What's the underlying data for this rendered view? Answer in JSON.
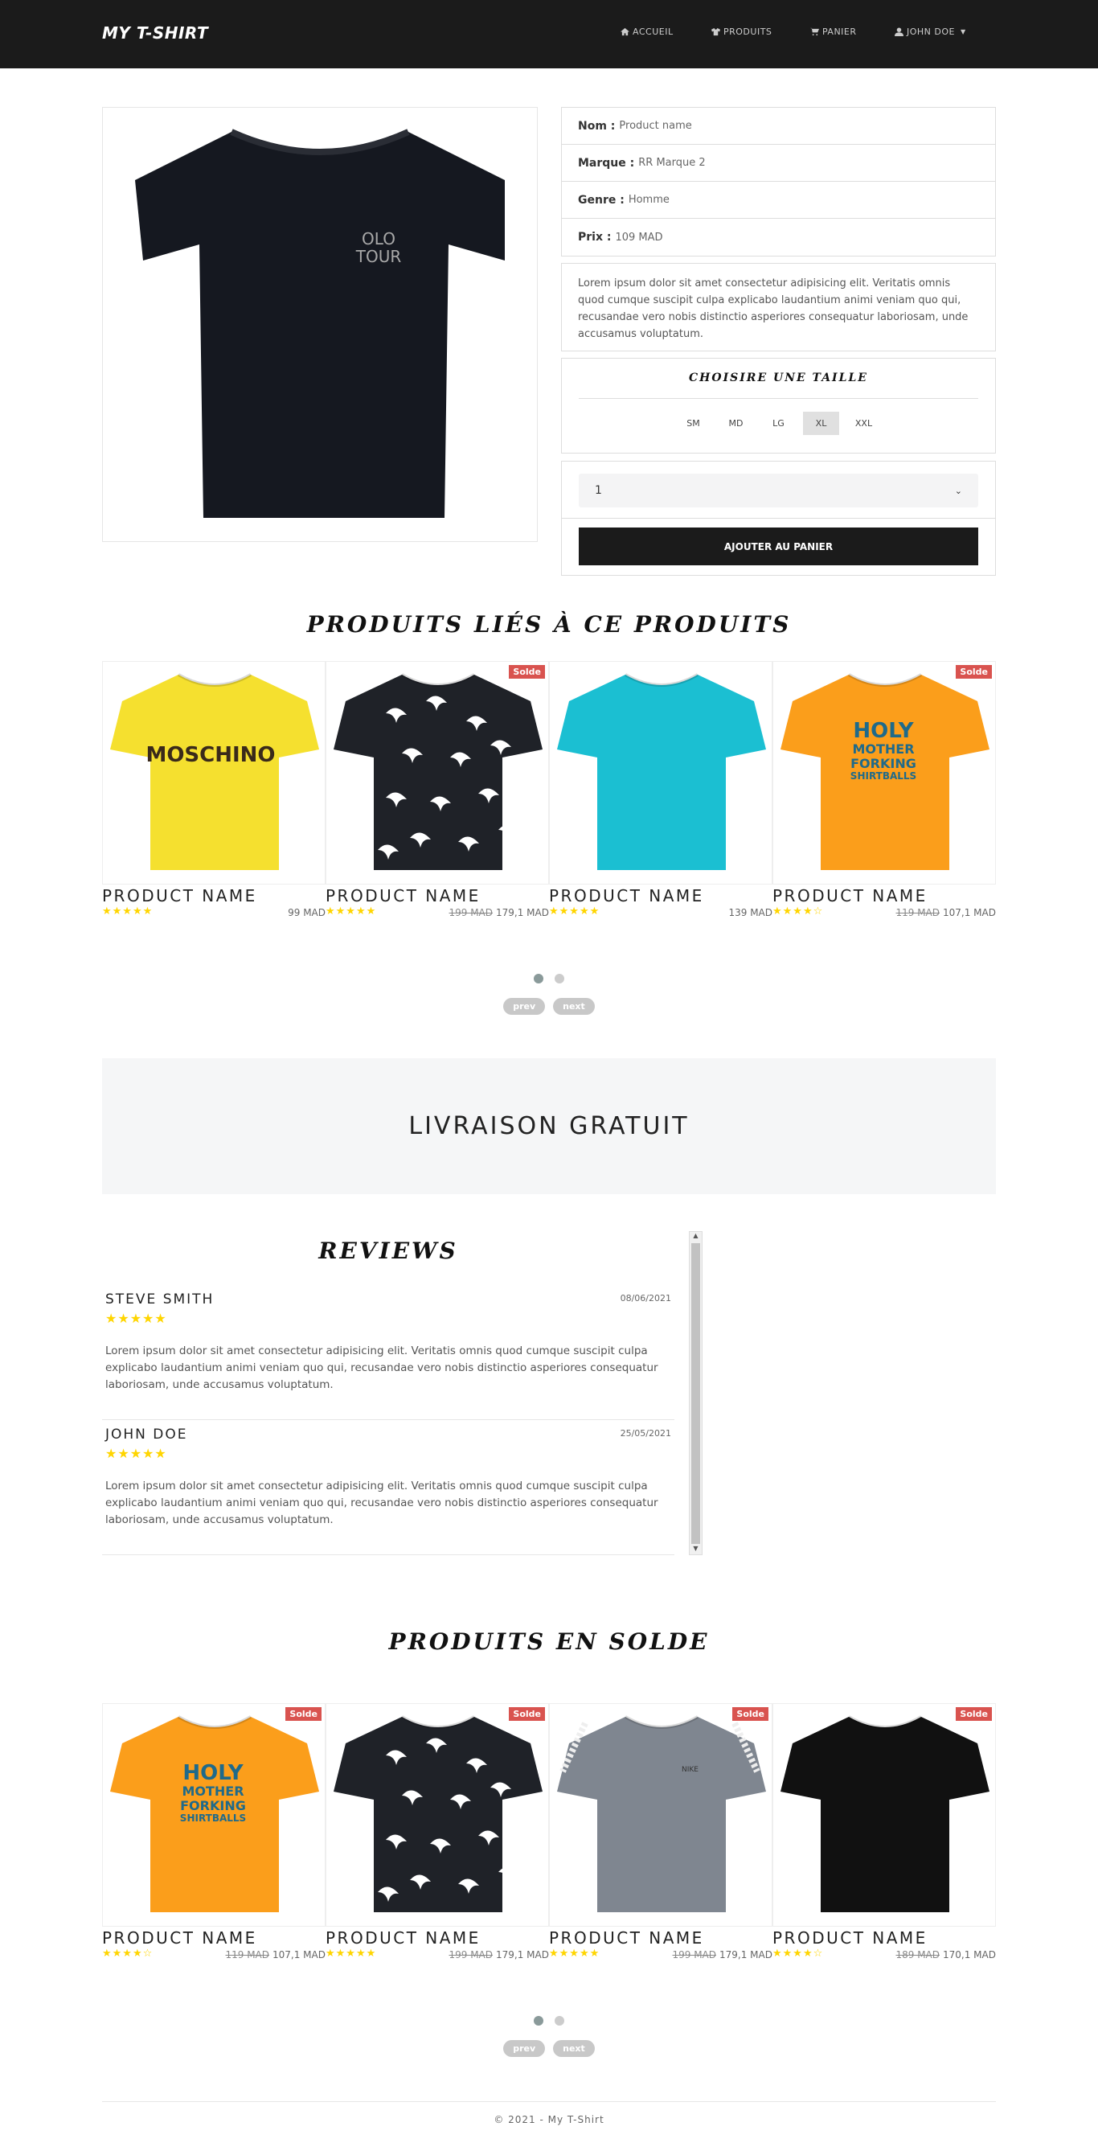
{
  "nav": {
    "brand": "MY T-SHIRT",
    "items": [
      {
        "label": "ACCUEIL",
        "icon": "home-icon"
      },
      {
        "label": "PRODUITS",
        "icon": "tshirt-icon"
      },
      {
        "label": "PANIER",
        "icon": "cart-icon"
      },
      {
        "label": "JOHN DOE",
        "icon": "user-icon"
      }
    ]
  },
  "product": {
    "fields": [
      {
        "label": "Nom :",
        "value": "Product name"
      },
      {
        "label": "Marque :",
        "value": "RR Marque 2"
      },
      {
        "label": "Genre :",
        "value": "Homme"
      },
      {
        "label": "Prix :",
        "value": "109 MAD"
      }
    ],
    "description": "Lorem ipsum dolor sit amet consectetur adipisicing elit. Veritatis omnis quod cumque suscipit culpa explicabo laudantium animi veniam quo qui, recusandae vero nobis distinctio asperiores consequatur laboriosam, unde accusamus voluptatum.",
    "size_title": "CHOISIRE UNE TAILLE",
    "sizes": [
      "SM",
      "MD",
      "LG",
      "XL",
      "XXL"
    ],
    "selected_size": "XL",
    "quantity": "1",
    "add_label": "AJOUTER AU PANIER",
    "image_text": {
      "line1": "OLO",
      "line2": "TOUR"
    }
  },
  "related": {
    "title": "PRODUITS LIÉS À CE PRODUITS",
    "items": [
      {
        "name": "PRODUCT NAME",
        "stars": "★★★★★",
        "old": "",
        "price": "99 MAD",
        "solde": "",
        "color": "#f5e02f",
        "print": "MOSCHINO"
      },
      {
        "name": "PRODUCT NAME",
        "stars": "★★★★★",
        "old": "199 MAD",
        "price": "179,1 MAD",
        "solde": "Solde",
        "color": "#1f2228",
        "print": "birds"
      },
      {
        "name": "PRODUCT NAME",
        "stars": "★★★★★",
        "old": "",
        "price": "139 MAD",
        "solde": "",
        "color": "#1bbfd2",
        "print": ""
      },
      {
        "name": "PRODUCT NAME",
        "stars": "★★★★☆",
        "old": "119 MAD",
        "price": "107,1 MAD",
        "solde": "Solde",
        "color": "#fb9e1b",
        "print": "HOLY"
      }
    ],
    "prev": "prev",
    "next": "next"
  },
  "shipping": "LIVRAISON GRATUIT",
  "reviews": {
    "title": "REVIEWS",
    "items": [
      {
        "name": "STEVE SMITH",
        "date": "08/06/2021",
        "stars": "★★★★★",
        "text": "Lorem ipsum dolor sit amet consectetur adipisicing elit. Veritatis omnis quod cumque suscipit culpa explicabo laudantium animi veniam quo qui, recusandae vero nobis distinctio asperiores consequatur laboriosam, unde accusamus voluptatum."
      },
      {
        "name": "JOHN DOE",
        "date": "25/05/2021",
        "stars": "★★★★★",
        "text": "Lorem ipsum dolor sit amet consectetur adipisicing elit. Veritatis omnis quod cumque suscipit culpa explicabo laudantium animi veniam quo qui, recusandae vero nobis distinctio asperiores consequatur laboriosam, unde accusamus voluptatum."
      }
    ]
  },
  "sale": {
    "title": "PRODUITS EN SOLDE",
    "items": [
      {
        "name": "PRODUCT NAME",
        "stars": "★★★★☆",
        "old": "119 MAD",
        "price": "107,1 MAD",
        "solde": "Solde",
        "color": "#fb9e1b",
        "print": "HOLY"
      },
      {
        "name": "PRODUCT NAME",
        "stars": "★★★★★",
        "old": "199 MAD",
        "price": "179,1 MAD",
        "solde": "Solde",
        "color": "#1f2228",
        "print": "birds"
      },
      {
        "name": "PRODUCT NAME",
        "stars": "★★★★★",
        "old": "199 MAD",
        "price": "179,1 MAD",
        "solde": "Solde",
        "color": "#7f8690",
        "print": "stripe"
      },
      {
        "name": "PRODUCT NAME",
        "stars": "★★★★☆",
        "old": "189 MAD",
        "price": "170,1 MAD",
        "solde": "Solde",
        "color": "#111111",
        "print": ""
      }
    ],
    "prev": "prev",
    "next": "next"
  },
  "footer": "© 2021 - My T-Shirt"
}
